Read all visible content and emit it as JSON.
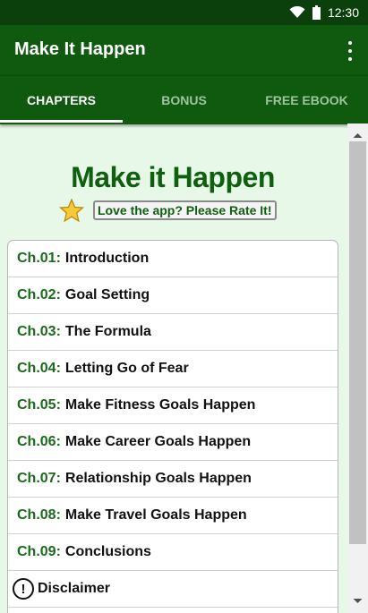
{
  "status": {
    "time": "12:30"
  },
  "app": {
    "title": "Make It Happen"
  },
  "tabs": [
    {
      "label": "CHAPTERS",
      "active": true
    },
    {
      "label": "BONUS",
      "active": false
    },
    {
      "label": "FREE EBOOK",
      "active": false
    }
  ],
  "main": {
    "book_title": "Make it Happen",
    "rate_label": "Love the app? Please Rate It!"
  },
  "chapters": [
    {
      "num": "Ch.01",
      "title": "Introduction"
    },
    {
      "num": "Ch.02",
      "title": "Goal Setting"
    },
    {
      "num": "Ch.03",
      "title": "The Formula"
    },
    {
      "num": "Ch.04",
      "title": "Letting Go of Fear"
    },
    {
      "num": "Ch.05",
      "title": "Make Fitness Goals Happen"
    },
    {
      "num": "Ch.06",
      "title": "Make Career Goals Happen"
    },
    {
      "num": "Ch.07",
      "title": "Relationship Goals Happen"
    },
    {
      "num": "Ch.08",
      "title": "Make Travel Goals Happen"
    },
    {
      "num": "Ch.09",
      "title": "Conclusions"
    }
  ],
  "disclaimer": {
    "icon_glyph": "!",
    "label": "Disclaimer"
  },
  "colors": {
    "primary": "#0f5a0f",
    "status_bar": "#0b3f0b",
    "accent_text": "#0e5f0e",
    "background": "#e8f8e8"
  }
}
